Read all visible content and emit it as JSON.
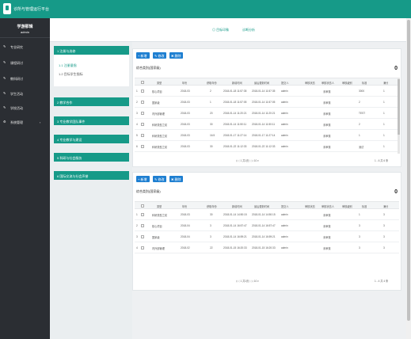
{
  "app": {
    "title": "诊所与管理运行平台"
  },
  "user": {
    "name": "学游那辑",
    "role": "admin"
  },
  "sidebar": {
    "items": [
      {
        "label": "专业研究",
        "icon": "pencil-icon"
      },
      {
        "label": "课程研讨",
        "icon": "pencil-icon"
      },
      {
        "label": "教科研讨",
        "icon": "pencil-icon"
      },
      {
        "label": "学生活动",
        "icon": "pencil-icon"
      },
      {
        "label": "学校活动",
        "icon": "pencil-icon"
      },
      {
        "label": "系统管理",
        "icon": "gear-icon",
        "chevron": "‹"
      }
    ]
  },
  "tabs": [
    {
      "label": "◎ 目标印象"
    },
    {
      "label": "诊断分析"
    }
  ],
  "left": {
    "sections": [
      {
        "label": "1 注册与选修"
      },
      {
        "label": "2 教学合作"
      },
      {
        "label": "3 专业教学团队事件"
      },
      {
        "label": "4 专业教学与建设"
      },
      {
        "label": "5 科研与社会服务"
      },
      {
        "label": "6 国际交流与社会声誉"
      }
    ],
    "sub_items": [
      {
        "label": "1.1 注册量指"
      },
      {
        "label": "1.2 目标学生指标"
      }
    ]
  },
  "toolbar": {
    "add": "+ 新增",
    "edit": "✎ 修改",
    "delete": "✖ 删除"
  },
  "table1": {
    "title": "综合类别(国家级)",
    "count": "0",
    "headers": [
      "",
      "",
      "类型",
      "年份",
      "获取年份",
      "新增时间",
      "最后更新时间",
      "提交人",
      "审核状态",
      "审核状态人",
      "审核级别",
      "标准",
      "满分"
    ],
    "rows": [
      [
        "1",
        "",
        "核心项目",
        "2018-03",
        "2",
        "2018-01-18 11:57:35",
        "2018-01-14 11:57:35",
        "admin",
        "",
        "未审核",
        "3000",
        "1",
        ""
      ],
      [
        "2",
        "",
        "国家级",
        "2018-03",
        "1",
        "2018-01-18 11:57:05",
        "2018-01-14 11:57:05",
        "admin",
        "",
        "未审核",
        "2",
        "1",
        ""
      ],
      [
        "3",
        "",
        "内外部管理",
        "2018-03",
        "20",
        "2018-01-14 11:20:21",
        "2018-01-14 11:20:21",
        "admin",
        "",
        "未审核",
        "TEST",
        "1",
        ""
      ],
      [
        "4",
        "",
        "科研类型之前",
        "2018-03",
        "30",
        "2018-01-14 11:50:11",
        "2018-01-14 11:50:11",
        "admin",
        "",
        "未审核",
        "2",
        "1",
        ""
      ],
      [
        "5",
        "",
        "科研类型之前",
        "2018-03",
        "16.5",
        "2018-01-17 11:27:14",
        "2018-01-17 11:27:14",
        "admin",
        "",
        "未审核",
        "1",
        "1",
        ""
      ],
      [
        "6",
        "",
        "科研类型之前",
        "2018-03",
        "30",
        "2018-01-22 11:12:33",
        "2018-01-22 11:12:33",
        "admin",
        "",
        "未审核",
        "测试",
        "1",
        ""
      ]
    ],
    "pager": "⟨⟨ ⟨ 1 共1页 ⟩ ⟩⟩ 10 ▾",
    "pager_right": "1 - 6 共 6 条"
  },
  "table2": {
    "title": "综合类别(国家级)",
    "count": "0",
    "headers": [
      "",
      "",
      "类型",
      "年份",
      "获取年份",
      "新增时间",
      "最后更新时间",
      "提交人",
      "审核状态",
      "审核状态人",
      "审核级别",
      "标准",
      "满分"
    ],
    "rows": [
      [
        "1",
        "",
        "科研类型之前",
        "2018-03",
        "30",
        "2018-01-14 14:50:15",
        "2018-01-14 14:50:15",
        "admin",
        "",
        "未审核",
        "1",
        "3",
        ""
      ],
      [
        "2",
        "",
        "核心项目",
        "2018-04",
        "3",
        "2018-01-14 16:57:47",
        "2018-01-14 16:57:47",
        "admin",
        "",
        "未审核",
        "3",
        "3",
        ""
      ],
      [
        "3",
        "",
        "国家级",
        "2018-04",
        "3",
        "2018-01-14 16:59:21",
        "2018-01-14 16:59:21",
        "admin",
        "",
        "未审核",
        "3",
        "3",
        ""
      ],
      [
        "4",
        "",
        "内外部管理",
        "2018-02",
        "22",
        "2018-01-15 16:20:33",
        "2018-01-15 16:20:33",
        "admin",
        "",
        "未审核",
        "3",
        "3",
        ""
      ]
    ],
    "pager": "⟨⟨ ⟨ 1 共1页 ⟩ ⟩⟩ 10 ▾",
    "pager_right": "1 - 4 共 4 条"
  },
  "colors": {
    "brand": "#169a88",
    "sidebar": "#2b2e33",
    "button": "#1e7fd1"
  }
}
